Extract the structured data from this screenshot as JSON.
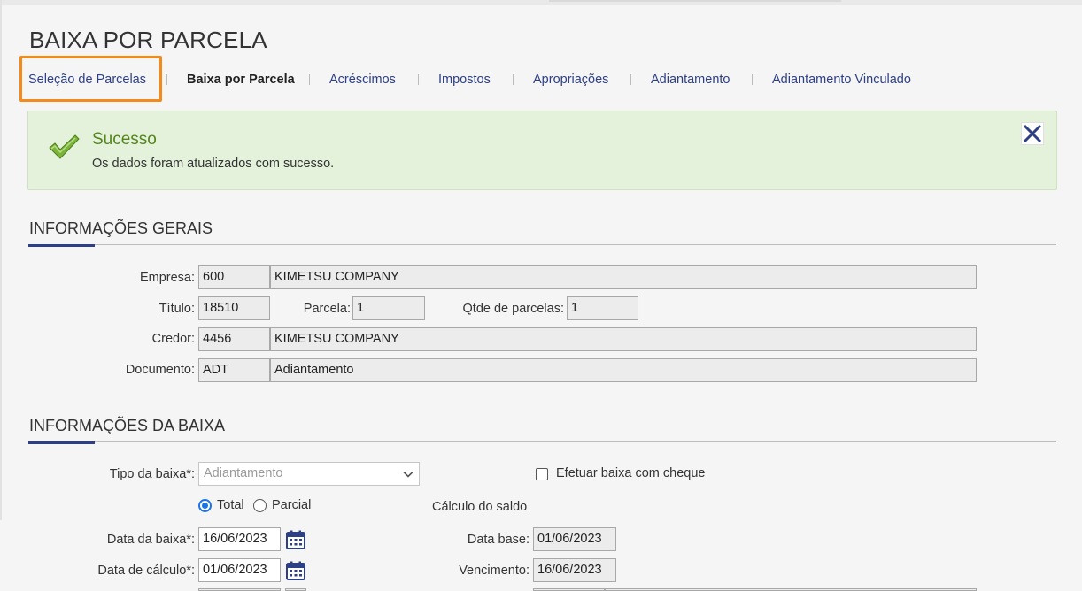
{
  "page": {
    "title": "BAIXA POR PARCELA"
  },
  "tabs": [
    {
      "label": "Seleção de Parcelas"
    },
    {
      "label": "Baixa por Parcela"
    },
    {
      "label": "Acréscimos"
    },
    {
      "label": "Impostos"
    },
    {
      "label": "Apropriações"
    },
    {
      "label": "Adiantamento"
    },
    {
      "label": "Adiantamento Vinculado"
    }
  ],
  "alert": {
    "title": "Sucesso",
    "message": "Os dados foram atualizados com sucesso."
  },
  "general": {
    "title": "INFORMAÇÕES GERAIS",
    "empresa_label": "Empresa:",
    "empresa_code": "600",
    "empresa_name": "KIMETSU COMPANY",
    "titulo_label": "Título:",
    "titulo_value": "18510",
    "parcela_label": "Parcela:",
    "parcela_value": "1",
    "qtde_label": "Qtde de parcelas:",
    "qtde_value": "1",
    "credor_label": "Credor:",
    "credor_code": "4456",
    "credor_name": "KIMETSU COMPANY",
    "documento_label": "Documento:",
    "documento_code": "ADT",
    "documento_name": "Adiantamento"
  },
  "baixa": {
    "title": "INFORMAÇÕES DA BAIXA",
    "tipo_label": "Tipo da baixa*:",
    "tipo_value": "Adiantamento",
    "cheque_label": "Efetuar baixa com cheque",
    "radio_total": "Total",
    "radio_parcial": "Parcial",
    "selected": "Total",
    "calculo_label": "Cálculo do saldo",
    "data_baixa_label": "Data da baixa*:",
    "data_baixa_value": "16/06/2023",
    "data_calculo_label": "Data de cálculo*:",
    "data_calculo_value": "01/06/2023",
    "data_base_label": "Data base:",
    "data_base_value": "01/06/2023",
    "vencimento_label": "Vencimento:",
    "vencimento_value": "16/06/2023"
  },
  "colors": {
    "accent": "#2d3f85",
    "highlight": "#f28a1c",
    "success": "#55861c",
    "success_bg": "#e4f2dc",
    "radio": "#1a73e8"
  },
  "icons": [
    "check-icon",
    "close-icon",
    "chevron-down-icon",
    "calendar-icon"
  ]
}
